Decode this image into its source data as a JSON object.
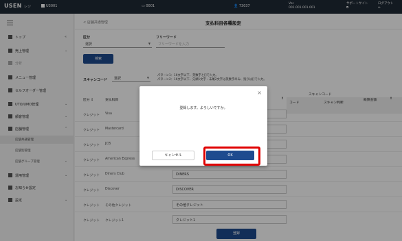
{
  "topbar": {
    "logo": "USEN",
    "logo_sub": "レジ",
    "store": "U3001",
    "terminal": "0001",
    "user": "73037",
    "ver_label": "Ver.",
    "ver_value": "001.001.001.001",
    "support": "サポートサイト",
    "logout": "ログアウト"
  },
  "sidebar": {
    "items": [
      {
        "label": "トップ"
      },
      {
        "label": "売上管理"
      },
      {
        "label": "分析"
      },
      {
        "label": "メニュー管理"
      },
      {
        "label": "セルフオーダー管理"
      },
      {
        "label": "UTO/UMO管理"
      },
      {
        "label": "顧客管理"
      },
      {
        "label": "店舗管理"
      },
      {
        "label": "運用管理"
      },
      {
        "label": "お知らせ設定"
      },
      {
        "label": "設定"
      }
    ],
    "subitems": [
      {
        "label": "店舗共通管理"
      },
      {
        "label": "店舗別管理"
      },
      {
        "label": "店舗グループ管理"
      }
    ]
  },
  "main": {
    "breadcrumb": "< 店舗共通管理",
    "title": "支払科目各種設定",
    "filters": {
      "category_label": "区分",
      "category_value": "選択",
      "freeword_label": "フリーワード",
      "freeword_placeholder": "フリーワードを入力",
      "search_button": "検索",
      "scancode_label": "スキャンコード",
      "scancode_value": "選択",
      "note1": "パターン1：16文字以下、英数字と[]で入力。",
      "note2": "パターン2：16文字以下、先頭1文字・末尾2文字は英数字のみ、残りは[]で入力。"
    },
    "table": {
      "col_category": "区分",
      "col_item": "支払科目",
      "col_scancode": "スキャンコード",
      "col_code": "コード",
      "col_scan_judge": "スキャン判断",
      "col_prelim": "概算金額",
      "rows": [
        {
          "kubun": "クレジット",
          "name": "Visa",
          "value": ""
        },
        {
          "kubun": "クレジット",
          "name": "Mastercard",
          "value": ""
        },
        {
          "kubun": "クレジット",
          "name": "JCB",
          "value": ""
        },
        {
          "kubun": "クレジット",
          "name": "American Express",
          "value": ""
        },
        {
          "kubun": "クレジット",
          "name": "Diners Club",
          "value": "DINERS"
        },
        {
          "kubun": "クレジット",
          "name": "Discover",
          "value": "DISCOVER"
        },
        {
          "kubun": "クレジット",
          "name": "その他クレジット",
          "value": "その他クレジット"
        },
        {
          "kubun": "クレジット",
          "name": "クレジット1",
          "value": "クレジット1"
        }
      ]
    },
    "register_button": "登録"
  },
  "modal": {
    "message": "登録します。よろしいですか。",
    "cancel": "キャンセル",
    "ok": "OK",
    "close_glyph": "×"
  }
}
